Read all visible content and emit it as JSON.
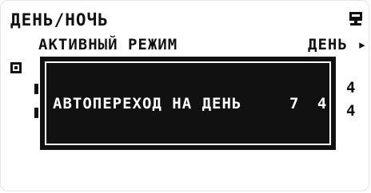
{
  "screen": {
    "title": "ДЕНЬ/НОЧЬ",
    "mode_label": "АКТИВНЫЙ РЕЖИМ",
    "mode_value": "ДЕНЬ ▸",
    "right_digits": [
      "4",
      "4"
    ]
  },
  "popup": {
    "label": "АВТОПЕРЕХОД НА ДЕНЬ",
    "value": "7 4"
  },
  "icons": {
    "top_right": "monitor-icon",
    "left_marker": "checkbox-icon"
  },
  "colors": {
    "foreground": "#111111",
    "background": "#ffffff"
  }
}
